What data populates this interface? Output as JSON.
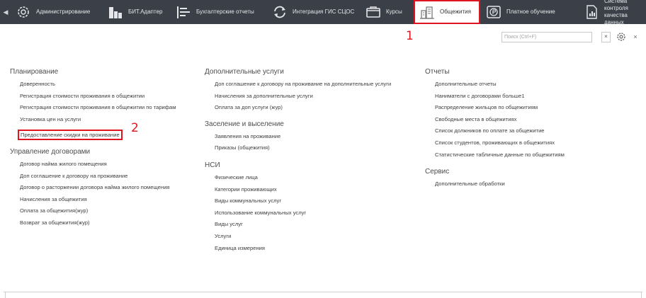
{
  "sections": [
    {
      "label": "Администрирование",
      "icon": "gear-icon"
    },
    {
      "label": "БИТ.Адаптер",
      "icon": "building-blocks-icon"
    },
    {
      "label": "Бухгалтерские отчеты",
      "icon": "report-lines-icon"
    },
    {
      "label": "Интеграция ГИС СЦОС",
      "icon": "sync-arrows-icon"
    },
    {
      "label": "Курсы",
      "icon": "folder-icon"
    },
    {
      "label": "Общежития",
      "icon": "dormitory-buildings-icon"
    },
    {
      "label": "Платное обучение",
      "icon": "coin-rubles-icon"
    },
    {
      "label": "Система контроля качества данных",
      "icon": "quality-chart-icon"
    }
  ],
  "search": {
    "placeholder": "Поиск (Ctrl+F)",
    "clear": "×"
  },
  "window": {
    "close": "×"
  },
  "callouts": {
    "one": "1",
    "two": "2"
  },
  "menu": {
    "planning": {
      "title": "Планирование",
      "items": [
        "Доверенность",
        "Регистрация стоимости проживания в общежитии",
        "Регистрация стоимости проживания в общежитии по тарифам",
        "Установка цен на услуги",
        "Предоставление скидки на проживание"
      ]
    },
    "contracts": {
      "title": "Управление договорами",
      "items": [
        "Договор найма жилого помещения",
        "Доп соглашение к договору на проживание",
        "Договор о расторжении договора найма жилого помещения",
        "Начисления за общежития",
        "Оплата за общежития(жур)",
        "Возврат за общежития(жур)"
      ]
    },
    "extra": {
      "title": "Дополнительные услуги",
      "items": [
        "Доп соглашение к договору на проживание на дополнительные услуги",
        "Начисления за дополнительные услуги",
        "Оплата за доп услуги (жур)"
      ]
    },
    "settle": {
      "title": "Заселение и выселение",
      "items": [
        "Заявления на проживание",
        "Приказы (общежития)"
      ]
    },
    "nsi": {
      "title": "НСИ",
      "items": [
        "Физические лица",
        "Категории проживающих",
        "Виды коммунальных услуг",
        "Использование коммунальных услуг",
        "Виды услуг",
        "Услуги",
        "Единица измерения"
      ]
    },
    "reports": {
      "title": "Отчеты",
      "items": [
        "Дополнительные отчеты",
        "Наниматели с договорами больше1",
        "Распределение жильцов по общежитиям",
        "Свободные места в общежитиях",
        "Список должников по оплате за общежитие",
        "Список студентов, проживающих в общежитиях",
        "Статистические табличные данные по общежитиям"
      ]
    },
    "service": {
      "title": "Сервис",
      "items": [
        "Дополнительные обработки"
      ]
    }
  }
}
